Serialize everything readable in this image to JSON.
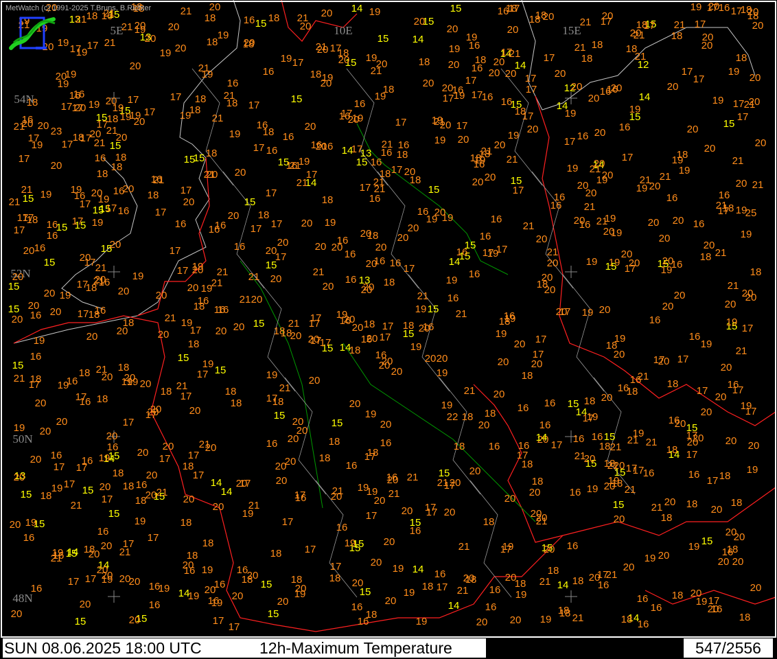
{
  "copyright": "MetWatch  (c) 1991-2025 T.Bruns, B.Richter",
  "date_label": "SUN 08.06.2025 18:00 UTC",
  "parameter_label": "12h-Maximum Temperature",
  "station_count": "547/2556",
  "grid_labels": [
    "5E",
    "10E",
    "15E",
    "54N",
    "52N",
    "50N",
    "48N"
  ],
  "colors": {
    "cold": "#ffff00",
    "warm": "#ff8c1a",
    "very_cold": "#00e000",
    "borders": "#ff2020",
    "rivers": "#009900",
    "coast": "#c8c8c8"
  },
  "stations": [
    "16",
    "16",
    "16",
    "14",
    "14",
    "14",
    "14",
    "16",
    "15",
    "15",
    "13",
    "16",
    "16",
    "15",
    "15",
    "15",
    "15",
    "14",
    "16",
    "18",
    "17",
    "17",
    "18",
    "13",
    "15",
    "14",
    "15",
    "15",
    "15",
    "16",
    "18",
    "19",
    "16",
    "16",
    "18",
    "12",
    "14",
    "16",
    "15",
    "15",
    "15",
    "17",
    "17",
    "18",
    "16",
    "17",
    "19",
    "15",
    "15",
    "16",
    "17",
    "19",
    "18",
    "20",
    "19",
    "18",
    "19",
    "13",
    "15",
    "14",
    "15",
    "16",
    "15",
    "17",
    "16",
    "18",
    "18",
    "18",
    "20",
    "13",
    "16",
    "15",
    "16",
    "16",
    "15",
    "17",
    "18",
    "18",
    "16",
    "14",
    "17",
    "14",
    "16",
    "15",
    "16",
    "16",
    "16",
    "17",
    "19",
    "18",
    "18",
    "21",
    "17",
    "16",
    "18",
    "14",
    "16",
    "16",
    "16",
    "18",
    "20",
    "16",
    "15",
    "16",
    "17",
    "18",
    "16",
    "16",
    "15",
    "15",
    "17",
    "17",
    "16",
    "17",
    "15",
    "17",
    "18",
    "17",
    "16",
    "20",
    "14",
    "15",
    "18",
    "16",
    "20",
    "17",
    "18",
    "19",
    "19",
    "18",
    "15",
    "14",
    "16",
    "17",
    "17",
    "18",
    "15",
    "16",
    "16",
    "18",
    "20",
    "15",
    "17",
    "15",
    "15",
    "16",
    "18",
    "18",
    "19",
    "20",
    "20",
    "15",
    "16",
    "15",
    "16",
    "14",
    "16",
    "16",
    "17",
    "19",
    "22",
    "20",
    "15",
    "14",
    "16",
    "16",
    "15",
    "18",
    "18",
    "16",
    "16",
    "16",
    "15",
    "16",
    "16",
    "20",
    "19",
    "16",
    "17",
    "15",
    "20",
    "17",
    "19",
    "15",
    "16",
    "16",
    "15",
    "17",
    "19",
    "20",
    "20",
    "20",
    "15",
    "14",
    "16",
    "15",
    "18",
    "16",
    "16",
    "17",
    "18",
    "21",
    "14",
    "15",
    "16",
    "16",
    "14",
    "15",
    "18",
    "18",
    "18",
    "20",
    "16",
    "17",
    "15",
    "16",
    "18",
    "19",
    "17",
    "17",
    "17",
    "18",
    "20",
    "19",
    "19",
    "17",
    "17",
    "12",
    "15",
    "16",
    "16",
    "16",
    "17",
    "19",
    "15",
    "17",
    "16",
    "17",
    "16",
    "14",
    "16",
    "16",
    "18",
    "17",
    "16",
    "17",
    "20",
    "19",
    "17",
    "19",
    "19",
    "18",
    "16",
    "15",
    "14",
    "16",
    "16",
    "17",
    "15",
    "15",
    "17",
    "18",
    "18",
    "20",
    "13",
    "15",
    "15",
    "18",
    "15",
    "16",
    "16",
    "17",
    "17",
    "18",
    "15",
    "16",
    "16",
    "17",
    "16",
    "16",
    "18",
    "19",
    "18",
    "15",
    "15",
    "15",
    "15",
    "17",
    "17",
    "17",
    "18",
    "16",
    "18",
    "18",
    "19",
    "20",
    "17",
    "16",
    "16",
    "15",
    "16",
    "14",
    "14",
    "15",
    "17",
    "18",
    "19",
    "17",
    "16",
    "16",
    "16",
    "15",
    "17",
    "15",
    "14",
    "17",
    "17",
    "17",
    "18",
    "18",
    "19",
    "19",
    "18",
    "20",
    "16",
    "19",
    "15",
    "16",
    "16",
    "16",
    "18",
    "20",
    "18",
    "19",
    "17",
    "18",
    "16",
    "16",
    "15",
    "17",
    "16",
    "15",
    "19",
    "19",
    "17",
    "15",
    "18",
    "17",
    "16",
    "17",
    "16",
    "15",
    "14",
    "15",
    "17",
    "16",
    "17",
    "17",
    "18",
    "17",
    "18",
    "19",
    "19",
    "19",
    "18",
    "20",
    "15",
    "16",
    "17",
    "17",
    "19",
    "16",
    "17",
    "17",
    "18",
    "17",
    "16",
    "16",
    "17",
    "16",
    "16",
    "18",
    "16",
    "17",
    "19",
    "17",
    "17",
    "18",
    "19",
    "17",
    "16",
    "17",
    "16",
    "17",
    "18",
    "17",
    "17",
    "16",
    "17",
    "17",
    "18",
    "17",
    "17",
    "17",
    "18",
    "18",
    "18",
    "18",
    "17",
    "17",
    "19",
    "18",
    "19",
    "18",
    "20",
    "17",
    "15",
    "18",
    "16",
    "16",
    "17",
    "18",
    "17",
    "18",
    "18",
    "19",
    "19",
    "18",
    "16",
    "17",
    "18",
    "20",
    "17",
    "16",
    "17",
    "18",
    "16",
    "16",
    "18",
    "19",
    "20",
    "19",
    "17",
    "17",
    "18",
    "19",
    "20",
    "19",
    "20",
    "20",
    "18",
    "19",
    "20",
    "17",
    "17",
    "19",
    "19",
    "19",
    "20",
    "20",
    "19",
    "20",
    "20",
    "16",
    "16",
    "18",
    "17",
    "18",
    "18",
    "19",
    "20",
    "19",
    "20",
    "20",
    "20",
    "17",
    "17",
    "17",
    "18",
    "18",
    "19",
    "19",
    "18",
    "19",
    "21",
    "21",
    "17",
    "20",
    "20",
    "19",
    "17",
    "18",
    "17",
    "18",
    "19",
    "20",
    "21",
    "21",
    "20",
    "20",
    "17",
    "17",
    "18",
    "18",
    "19",
    "20",
    "20",
    "20",
    "17",
    "17",
    "18",
    "16",
    "18",
    "18",
    "20",
    "21",
    "21",
    "19",
    "17",
    "18",
    "20",
    "19",
    "18",
    "19",
    "20",
    "20",
    "21",
    "18",
    "19",
    "20",
    "18",
    "20",
    "21",
    "18",
    "17",
    "20",
    "20",
    "19",
    "18",
    "18",
    "20",
    "19",
    "20",
    "20",
    "19",
    "19",
    "19",
    "17",
    "16",
    "19",
    "20",
    "21",
    "17",
    "20",
    "21",
    "19",
    "17",
    "16",
    "19",
    "18",
    "18",
    "19",
    "17",
    "19",
    "17",
    "21",
    "23",
    "19",
    "16",
    "17",
    "19",
    "20",
    "20",
    "16",
    "17",
    "20",
    "20",
    "20",
    "17",
    "18",
    "19",
    "19",
    "17",
    "18",
    "16",
    "18",
    "16",
    "17",
    "21",
    "20",
    "20",
    "18",
    "19",
    "20",
    "20",
    "20",
    "19",
    "21",
    "21",
    "20",
    "21",
    "21",
    "25",
    "20",
    "17",
    "18",
    "18",
    "16",
    "19",
    "21",
    "21",
    "19",
    "18",
    "20",
    "16",
    "16",
    "19",
    "18",
    "20",
    "20",
    "16",
    "18",
    "19",
    "20",
    "20",
    "21",
    "17",
    "17",
    "18",
    "17",
    "19",
    "21",
    "20",
    "20",
    "19",
    "20",
    "20",
    "20",
    "20",
    "21",
    "20",
    "20",
    "20",
    "20",
    "20",
    "21",
    "20",
    "20",
    "20",
    "21",
    "21",
    "21",
    "21",
    "20",
    "20",
    "21",
    "20",
    "17",
    "18",
    "16",
    "17",
    "17",
    "19",
    "19",
    "20",
    "19",
    "20",
    "20",
    "16",
    "18",
    "18",
    "20",
    "20",
    "20",
    "21",
    "20",
    "20",
    "21",
    "20",
    "19",
    "20",
    "19",
    "20",
    "20",
    "21",
    "21",
    "21",
    "21",
    "20",
    "20",
    "21",
    "19",
    "19",
    "20",
    "20",
    "20",
    "20",
    "19",
    "19",
    "20",
    "20",
    "20",
    "20",
    "21",
    "20",
    "19",
    "19",
    "20",
    "21",
    "19",
    "20",
    "20",
    "19",
    "20",
    "20",
    "20",
    "20",
    "20",
    "21",
    "19",
    "20",
    "19",
    "20",
    "20",
    "19",
    "18",
    "19",
    "20",
    "20",
    "19",
    "19",
    "19",
    "20",
    "19",
    "19",
    "18",
    "17",
    "18",
    "19",
    "19",
    "20",
    "20",
    "20",
    "20",
    "19",
    "18",
    "18",
    "20",
    "20",
    "20",
    "20",
    "21",
    "21",
    "21",
    "19",
    "20",
    "20",
    "20",
    "21",
    "20",
    "20",
    "20",
    "20",
    "21",
    "20",
    "20",
    "21",
    "20",
    "19",
    "20",
    "20",
    "20",
    "20",
    "20",
    "20",
    "21",
    "21",
    "20",
    "20",
    "20",
    "20",
    "20",
    "20",
    "20",
    "20",
    "21",
    "21",
    "20",
    "20",
    "20",
    "21",
    "20",
    "20",
    "19",
    "19",
    "20",
    "20",
    "20",
    "20",
    "20",
    "21",
    "20",
    "20",
    "20",
    "20",
    "20",
    "20",
    "20",
    "20",
    "20",
    "20",
    "20",
    "20",
    "21",
    "21",
    "21",
    "20",
    "20",
    "20",
    "21",
    "20",
    "21",
    "21",
    "20",
    "20",
    "20",
    "21",
    "21",
    "20",
    "20",
    "20",
    "21",
    "20",
    "21",
    "21",
    "20",
    "20",
    "21",
    "20",
    "20",
    "20",
    "20",
    "21",
    "20",
    "20",
    "20",
    "20",
    "21",
    "20",
    "20",
    "21",
    "20",
    "21",
    "20",
    "20",
    "20",
    "21",
    "20",
    "20",
    "20",
    "20",
    "21",
    "20",
    "20",
    "21",
    "20",
    "20",
    "20",
    "20",
    "21",
    "20",
    "21",
    "21",
    "21",
    "20",
    "21",
    "20",
    "20",
    "20",
    "21",
    "20",
    "21",
    "20",
    "21",
    "20",
    "21",
    "20",
    "21",
    "20",
    "21",
    "20",
    "20",
    "20",
    "21",
    "21",
    "20",
    "20",
    "21",
    "20",
    "21",
    "20",
    "21",
    "20",
    "21"
  ]
}
